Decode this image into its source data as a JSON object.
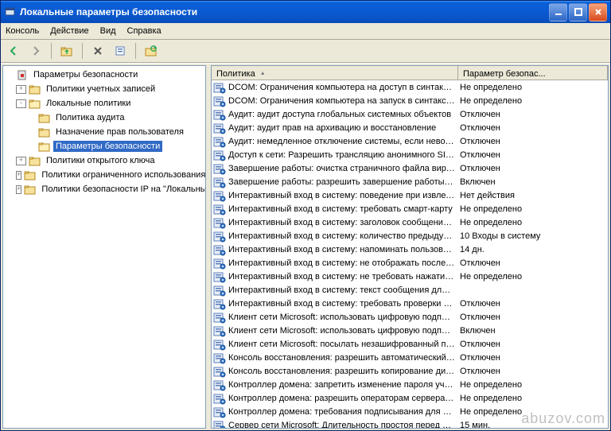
{
  "window": {
    "title": "Локальные параметры безопасности"
  },
  "menu": {
    "console": "Консоль",
    "action": "Действие",
    "view": "Вид",
    "help": "Справка"
  },
  "toolbar_icons": {
    "back": "back-arrow",
    "fwd": "forward-arrow",
    "up": "up-folder",
    "delete": "delete-x",
    "props": "properties",
    "refresh": "refresh"
  },
  "tree": {
    "root": "Параметры безопасности",
    "n1": "Политики учетных записей",
    "n2": "Локальные политики",
    "n2a": "Политика аудита",
    "n2b": "Назначение прав пользователя",
    "n2c": "Параметры безопасности",
    "n3": "Политики открытого ключа",
    "n4": "Политики ограниченного использования программ",
    "n5": "Политики безопасности IP на \"Локальный компьютер\""
  },
  "columns": {
    "policy": "Политика",
    "setting": "Параметр безопас..."
  },
  "rows": [
    {
      "p": "DCOM: Ограничения компьютера на доступ в синтаксисе ...",
      "s": "Не определено"
    },
    {
      "p": "DCOM: Ограничения компьютера на запуск в синтаксисе ...",
      "s": "Не определено"
    },
    {
      "p": "Аудит: аудит доступа глобальных системных объектов",
      "s": "Отключен"
    },
    {
      "p": "Аудит: аудит прав на архивацию и восстановление",
      "s": "Отключен"
    },
    {
      "p": "Аудит: немедленное отключение системы, если невозмо...",
      "s": "Отключен"
    },
    {
      "p": "Доступ к сети: Разрешить трансляцию анонимного SID в ...",
      "s": "Отключен"
    },
    {
      "p": "Завершение работы: очистка страничного файла вирту...",
      "s": "Отключен"
    },
    {
      "p": "Завершение работы: разрешить завершение работы сис...",
      "s": "Включен"
    },
    {
      "p": "Интерактивный вход в систему:  поведение при извлече...",
      "s": "Нет действия"
    },
    {
      "p": "Интерактивный вход в систему:  требовать смарт-карту",
      "s": "Не определено"
    },
    {
      "p": "Интерактивный вход в систему: заголовок сообщения д...",
      "s": "Не определено"
    },
    {
      "p": "Интерактивный вход в систему: количество предыдущи...",
      "s": "10 Входы в систему"
    },
    {
      "p": "Интерактивный вход в систему: напоминать пользовате...",
      "s": "14 дн."
    },
    {
      "p": "Интерактивный вход в систему: не отображать последн...",
      "s": "Отключен"
    },
    {
      "p": "Интерактивный вход в систему: не требовать нажатия С...",
      "s": "Не определено"
    },
    {
      "p": "Интерактивный вход в систему: текст сообщения для по...",
      "s": ""
    },
    {
      "p": "Интерактивный вход в систему: требовать проверки на ...",
      "s": "Отключен"
    },
    {
      "p": "Клиент сети Microsoft: использовать цифровую подпись (...",
      "s": "Отключен"
    },
    {
      "p": "Клиент сети Microsoft: использовать цифровую подпись (...",
      "s": "Включен"
    },
    {
      "p": "Клиент сети Microsoft: посылать незашифрованный паро...",
      "s": "Отключен"
    },
    {
      "p": "Консоль восстановления: разрешить автоматический вх...",
      "s": "Отключен"
    },
    {
      "p": "Консоль восстановления: разрешить копирование диске...",
      "s": "Отключен"
    },
    {
      "p": "Контроллер домена: запретить изменение пароля учетн...",
      "s": "Не определено"
    },
    {
      "p": "Контроллер домена: разрешить операторам сервера зад...",
      "s": "Не определено"
    },
    {
      "p": "Контроллер домена: требования подписывания для LDA...",
      "s": "Не определено"
    },
    {
      "p": "Сервер сети Microsoft: Длительность простоя перед отк...",
      "s": "15 мин."
    }
  ],
  "watermark": "abuzov.com"
}
